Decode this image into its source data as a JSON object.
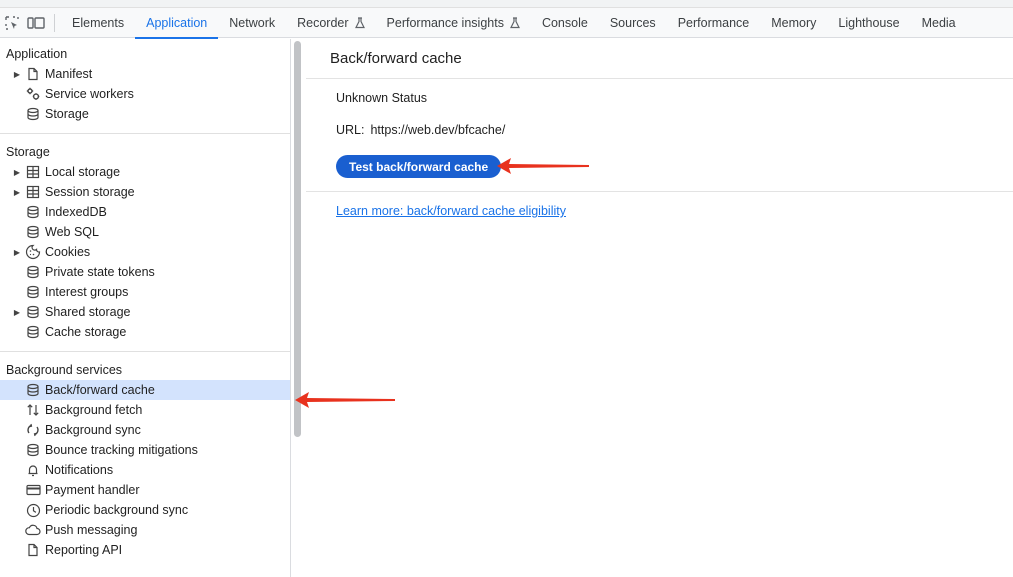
{
  "toolbar": {
    "icons": [
      "inspect-icon",
      "device-toolbar-icon"
    ],
    "tabs": [
      {
        "label": "Elements"
      },
      {
        "label": "Application",
        "active": true
      },
      {
        "label": "Network"
      },
      {
        "label": "Recorder",
        "flask": true
      },
      {
        "label": "Performance insights",
        "flask": true
      },
      {
        "label": "Console"
      },
      {
        "label": "Sources"
      },
      {
        "label": "Performance"
      },
      {
        "label": "Memory"
      },
      {
        "label": "Lighthouse"
      },
      {
        "label": "Media"
      }
    ]
  },
  "sidebar": {
    "sections": [
      {
        "title": "Application",
        "items": [
          {
            "label": "Manifest",
            "icon": "file-icon",
            "expandable": true
          },
          {
            "label": "Service workers",
            "icon": "gears-icon"
          },
          {
            "label": "Storage",
            "icon": "database-icon"
          }
        ]
      },
      {
        "title": "Storage",
        "items": [
          {
            "label": "Local storage",
            "icon": "table-icon",
            "expandable": true
          },
          {
            "label": "Session storage",
            "icon": "table-icon",
            "expandable": true
          },
          {
            "label": "IndexedDB",
            "icon": "database-icon"
          },
          {
            "label": "Web SQL",
            "icon": "database-icon"
          },
          {
            "label": "Cookies",
            "icon": "cookie-icon",
            "expandable": true
          },
          {
            "label": "Private state tokens",
            "icon": "database-icon"
          },
          {
            "label": "Interest groups",
            "icon": "database-icon"
          },
          {
            "label": "Shared storage",
            "icon": "database-icon",
            "expandable": true
          },
          {
            "label": "Cache storage",
            "icon": "database-icon"
          }
        ]
      },
      {
        "title": "Background services",
        "items": [
          {
            "label": "Back/forward cache",
            "icon": "database-icon",
            "selected": true
          },
          {
            "label": "Background fetch",
            "icon": "up-down-arrows-icon"
          },
          {
            "label": "Background sync",
            "icon": "sync-icon"
          },
          {
            "label": "Bounce tracking mitigations",
            "icon": "database-icon"
          },
          {
            "label": "Notifications",
            "icon": "bell-icon"
          },
          {
            "label": "Payment handler",
            "icon": "credit-card-icon"
          },
          {
            "label": "Periodic background sync",
            "icon": "clock-icon"
          },
          {
            "label": "Push messaging",
            "icon": "cloud-icon"
          },
          {
            "label": "Reporting API",
            "icon": "file-icon"
          }
        ]
      }
    ]
  },
  "main": {
    "title": "Back/forward cache",
    "status": "Unknown Status",
    "url_label": "URL:",
    "url_value": "https://web.dev/bfcache/",
    "test_button": "Test back/forward cache",
    "learn_more": "Learn more: back/forward cache eligibility"
  },
  "colors": {
    "accent": "#1a73e8",
    "button": "#1a5fd0",
    "selected_row": "#d3e3fd",
    "annotation_arrow": "#e8321e"
  }
}
